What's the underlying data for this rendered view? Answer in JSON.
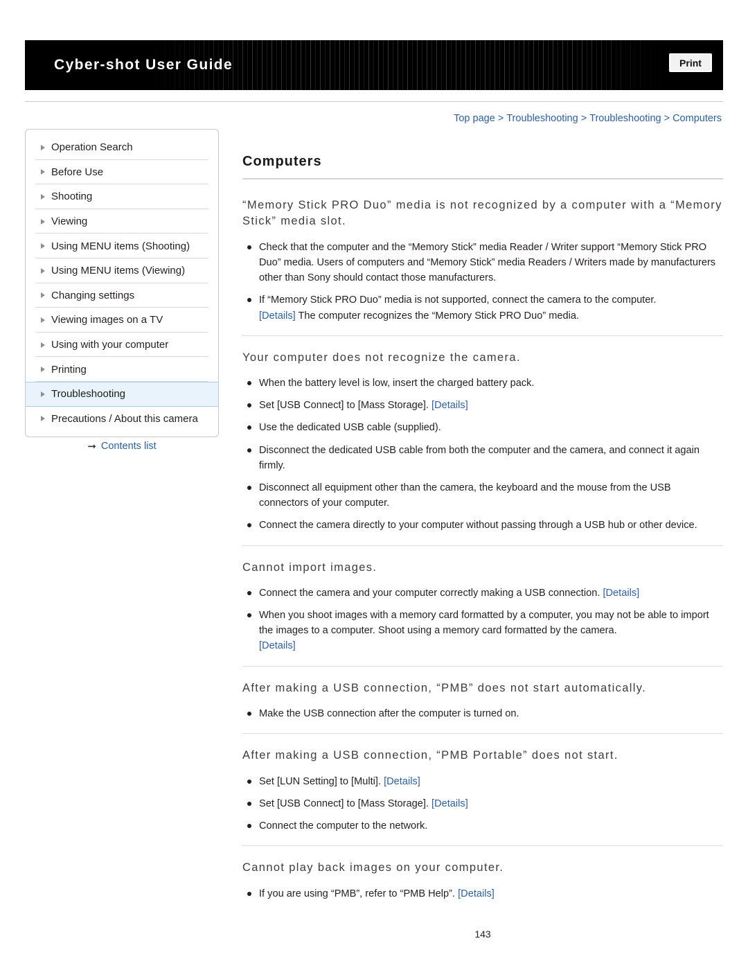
{
  "header": {
    "title": "Cyber-shot User Guide",
    "print_label": "Print"
  },
  "breadcrumb": {
    "items": [
      "Top page",
      "Troubleshooting",
      "Troubleshooting",
      "Computers"
    ],
    "separator": ">"
  },
  "sidebar": {
    "items": [
      {
        "label": "Operation Search"
      },
      {
        "label": "Before Use"
      },
      {
        "label": "Shooting"
      },
      {
        "label": "Viewing"
      },
      {
        "label": "Using MENU items (Shooting)"
      },
      {
        "label": "Using MENU items (Viewing)"
      },
      {
        "label": "Changing settings"
      },
      {
        "label": "Viewing images on a TV"
      },
      {
        "label": "Using with your computer"
      },
      {
        "label": "Printing"
      },
      {
        "label": "Troubleshooting"
      },
      {
        "label": "Precautions / About this camera"
      }
    ],
    "active_index": 10,
    "contents_list_label": "Contents list"
  },
  "main": {
    "page_title": "Computers",
    "page_number": "143",
    "sections": [
      {
        "heading": "“Memory Stick PRO Duo” media is not recognized by a computer with a “Memory Stick” media slot.",
        "bullets": [
          {
            "text": "Check that the computer and the “Memory Stick” media Reader / Writer support “Memory Stick PRO Duo” media. Users of computers and “Memory Stick” media Readers / Writers made by manufacturers other than Sony should contact those manufacturers."
          },
          {
            "text": "If “Memory Stick PRO Duo” media is not supported, connect the camera to the computer.",
            "link_before": "[Details]",
            "text_after": "The computer recognizes the “Memory Stick PRO Duo” media."
          }
        ]
      },
      {
        "heading": "Your computer does not recognize the camera.",
        "bullets": [
          {
            "text": "When the battery level is low, insert the charged battery pack."
          },
          {
            "text": "Set [USB Connect] to [Mass Storage].",
            "link_after": "[Details]"
          },
          {
            "text": "Use the dedicated USB cable (supplied)."
          },
          {
            "text": "Disconnect the dedicated USB cable from both the computer and the camera, and connect it again firmly."
          },
          {
            "text": "Disconnect all equipment other than the camera, the keyboard and the mouse from the USB connectors of your computer."
          },
          {
            "text": "Connect the camera directly to your computer without passing through a USB hub or other device."
          }
        ]
      },
      {
        "heading": "Cannot import images.",
        "bullets": [
          {
            "text": "Connect the camera and your computer correctly making a USB connection.",
            "link_after": "[Details]"
          },
          {
            "text": "When you shoot images with a memory card formatted by a computer, you may not be able to import the images to a computer. Shoot using a memory card formatted by the camera.",
            "link_line": "[Details]"
          }
        ]
      },
      {
        "heading": "After making a USB connection, “PMB” does not start automatically.",
        "bullets": [
          {
            "text": "Make the USB connection after the computer is turned on."
          }
        ]
      },
      {
        "heading": "After making a USB connection, “PMB Portable” does not start.",
        "bullets": [
          {
            "text": "Set [LUN Setting] to [Multi].",
            "link_after": "[Details]"
          },
          {
            "text": "Set [USB Connect] to [Mass Storage].",
            "link_after": "[Details]"
          },
          {
            "text": "Connect the computer to the network."
          }
        ]
      },
      {
        "heading": "Cannot play back images on your computer.",
        "bullets": [
          {
            "text": "If you are using “PMB”, refer to “PMB Help”.",
            "link_after": "[Details]"
          }
        ]
      }
    ]
  },
  "colors": {
    "link": "#2b5fa8",
    "active_nav_bg": "#e8f3fb",
    "banner_bg": "#000000"
  }
}
